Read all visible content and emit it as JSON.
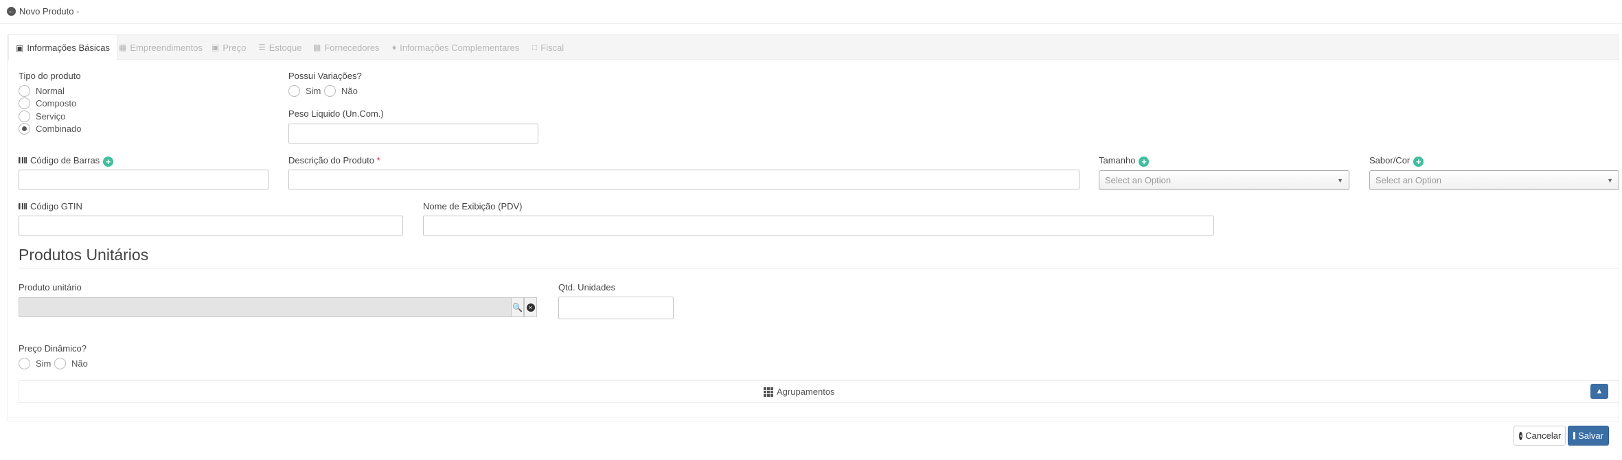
{
  "header": {
    "title": "Novo Produto -"
  },
  "tabs": [
    {
      "label": "Informações Básicas",
      "icon": "basket-icon",
      "active": true
    },
    {
      "label": "Empreendimentos",
      "icon": "building-icon",
      "active": false
    },
    {
      "label": "Preço",
      "icon": "tag-icon",
      "active": false
    },
    {
      "label": "Estoque",
      "icon": "list-icon",
      "active": false
    },
    {
      "label": "Fornecedores",
      "icon": "truck-icon",
      "active": false
    },
    {
      "label": "Informações Complementares",
      "icon": "cubes-icon",
      "active": false
    },
    {
      "label": "Fiscal",
      "icon": "file-icon",
      "active": false
    }
  ],
  "form": {
    "tipo_produto": {
      "label": "Tipo do produto",
      "options": [
        "Normal",
        "Composto",
        "Serviço",
        "Combinado"
      ],
      "selected": "Combinado"
    },
    "possui_variacoes": {
      "label": "Possui Variações?",
      "options": [
        "Sim",
        "Não"
      ]
    },
    "peso_liquido": {
      "label": "Peso Liquido (Un.Com.)",
      "value": ""
    },
    "codigo_barras": {
      "label": "Código de Barras",
      "value": ""
    },
    "descricao": {
      "label": "Descrição do Produto",
      "required_mark": "*",
      "value": ""
    },
    "tamanho": {
      "label": "Tamanho",
      "placeholder": "Select an Option"
    },
    "sabor_cor": {
      "label": "Sabor/Cor",
      "placeholder": "Select an Option"
    },
    "codigo_gtin": {
      "label": "Código GTIN",
      "value": ""
    },
    "nome_exibicao": {
      "label": "Nome de Exibição (PDV)",
      "value": ""
    }
  },
  "section": {
    "title": "Produtos Unitários",
    "produto_unitario": {
      "label": "Produto unitário",
      "value": ""
    },
    "qtd_unidades": {
      "label": "Qtd. Unidades",
      "value": ""
    },
    "preco_dinamico": {
      "label": "Preço Dinâmico?",
      "options": [
        "Sim",
        "Não"
      ]
    },
    "agrupamentos": {
      "label": "Agrupamentos"
    }
  },
  "actions": {
    "cancel": "Cancelar",
    "save": "Salvar"
  },
  "colors": {
    "primary": "#3b6ea5",
    "add": "#3fbf9f",
    "required": "#d23030"
  }
}
